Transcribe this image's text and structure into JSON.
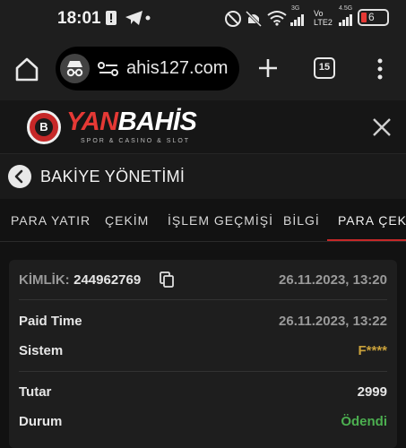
{
  "status_bar": {
    "time": "18:01",
    "network_3g": "3G",
    "network_4g": "4.5G",
    "volte": "Vo LTE2",
    "battery": "6"
  },
  "browser": {
    "url": "ahis127.com",
    "tab_count": "15"
  },
  "site": {
    "logo_yan": "YAN",
    "logo_bahis": "BAHİS",
    "logo_subtitle": "SPOR & CASINO & SLOT",
    "logo_mark": "B"
  },
  "page": {
    "title": "BAKİYE YÖNETİMİ"
  },
  "tabs": [
    {
      "label": "PARA YATIR"
    },
    {
      "label": "ÇEKİM"
    },
    {
      "label": "İŞLEM GEÇMİŞİ"
    },
    {
      "label": "BİLGİ"
    },
    {
      "label": "PARA ÇEKME"
    }
  ],
  "record": {
    "id_label": "KİMLİK:",
    "id_value": "244962769",
    "created": "26.11.2023, 13:20",
    "paid_time_label": "Paid Time",
    "paid_time_value": "26.11.2023, 13:22",
    "system_label": "Sistem",
    "system_value": "F****",
    "amount_label": "Tutar",
    "amount_value": "2999",
    "status_label": "Durum",
    "status_value": "Ödendi"
  },
  "colors": {
    "accent": "#c62828",
    "paid_green": "#4caf50",
    "system_gold": "#c9a13b"
  }
}
